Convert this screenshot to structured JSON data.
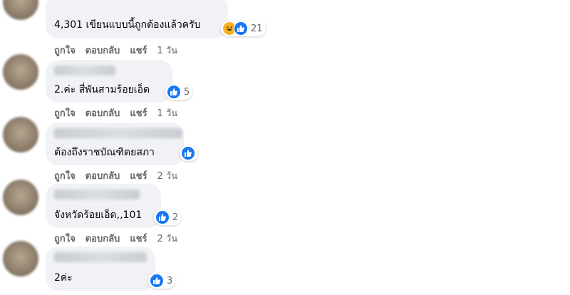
{
  "comments": [
    {
      "text": "4,301 เขียนแบบนี้ถูกต้องแล้วครับ",
      "reactions": [
        "haha-icon",
        "like-icon"
      ],
      "reaction_count": "21",
      "actions": {
        "like": "ถูกใจ",
        "reply": "ตอบกลับ",
        "share": "แชร์",
        "time": "1 วัน"
      }
    },
    {
      "text": "2.ค่ะ สี่พันสามร้อยเอ็ด",
      "reactions": [
        "like-icon"
      ],
      "reaction_count": "5",
      "actions": {
        "like": "ถูกใจ",
        "reply": "ตอบกลับ",
        "share": "แชร์",
        "time": "1 วัน"
      }
    },
    {
      "text": "ต้องถึงราชบัณฑิตยสภา",
      "reactions": [
        "like-icon"
      ],
      "reaction_count": "",
      "actions": {
        "like": "ถูกใจ",
        "reply": "ตอบกลับ",
        "share": "แชร์",
        "time": "2 วัน"
      }
    },
    {
      "text": "จังหวัดร้อยเอ็ด,,101",
      "reactions": [
        "like-icon"
      ],
      "reaction_count": "2",
      "actions": {
        "like": "ถูกใจ",
        "reply": "ตอบกลับ",
        "share": "แชร์",
        "time": "2 วัน"
      }
    },
    {
      "text": "2ค่ะ",
      "reactions": [
        "like-icon"
      ],
      "reaction_count": "3"
    }
  ],
  "colors": {
    "bubble": "#f0f2f5",
    "like": "#1877f2",
    "haha": "#f7b125",
    "meta": "#65676b"
  }
}
